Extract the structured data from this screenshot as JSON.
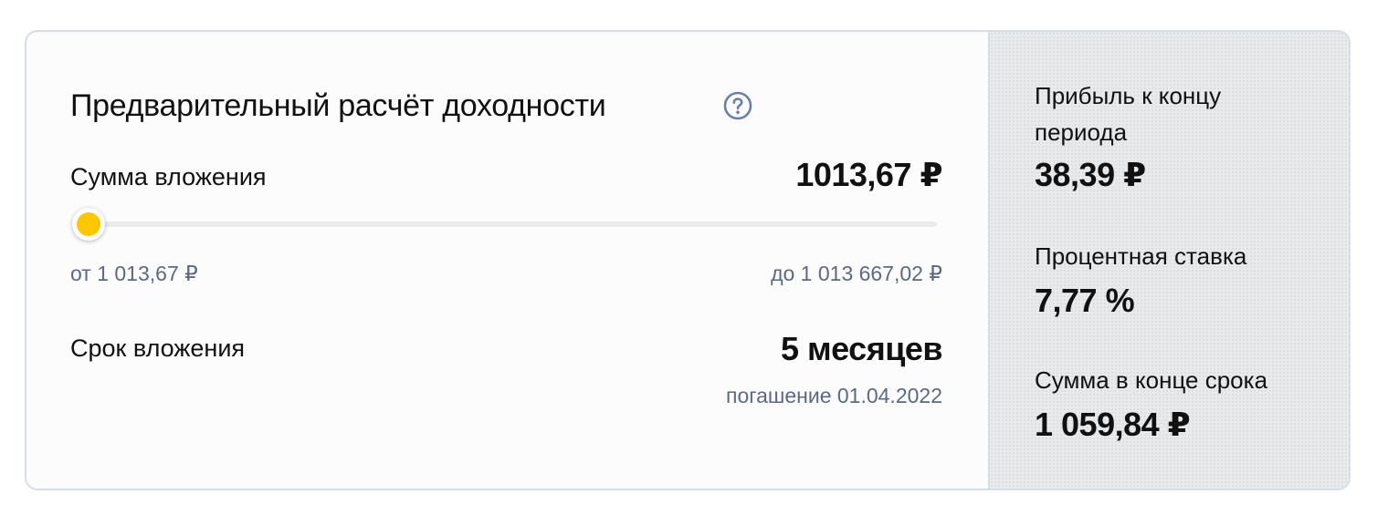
{
  "calculator": {
    "title": "Предварительный расчёт доходности",
    "help_icon": "question-circle-icon",
    "amount": {
      "label": "Сумма вложения",
      "value": "1013,67 ₽",
      "min_label": "от 1 013,67 ₽",
      "max_label": "до 1 013 667,02 ₽",
      "slider_fraction": 0
    },
    "term": {
      "label": "Срок вложения",
      "value": "5 месяцев",
      "maturity": "погашение 01.04.2022"
    }
  },
  "summary": {
    "profit_label": "Прибыль к концу периода",
    "profit_value": "38,39 ₽",
    "rate_label": "Процентная ставка",
    "rate_value": "7,77 %",
    "total_label": "Сумма в конце срока",
    "total_value": "1 059,84 ₽"
  },
  "colors": {
    "accent": "#ffc700",
    "muted_text": "#5b6982",
    "icon": "#6b7fa8",
    "border": "#d6dce8"
  }
}
